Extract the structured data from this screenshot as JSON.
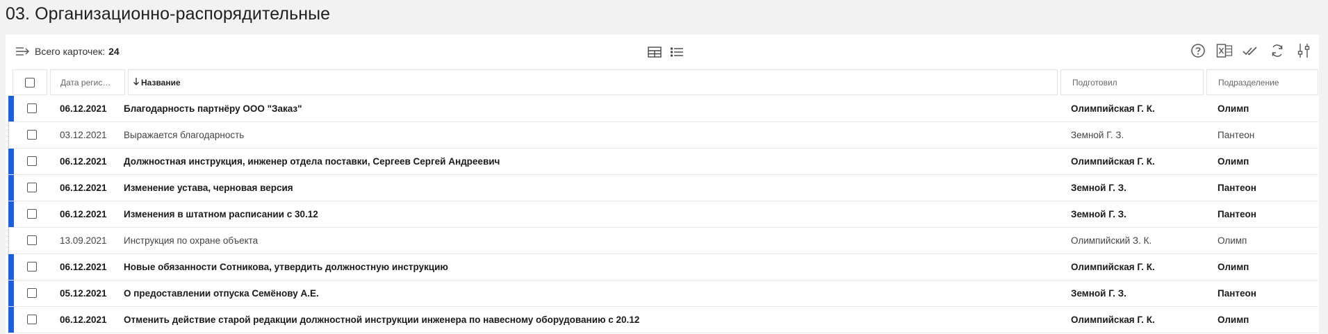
{
  "page": {
    "title": "03. Организационно-распорядительные"
  },
  "toolbar": {
    "count_label": "Всего карточек:",
    "count_value": "24",
    "icons": {
      "menu": "menu-arrow-icon",
      "table_view": "table-view-icon",
      "list_view": "list-view-icon",
      "help": "help-icon",
      "excel": "excel-export-icon",
      "mark_read": "double-check-icon",
      "refresh": "refresh-icon",
      "settings": "sliders-icon"
    }
  },
  "table": {
    "sort_column": "name",
    "sort_direction": "desc",
    "headers": {
      "date": "Дата регис…",
      "name": "Название",
      "author": "Подготовил",
      "department": "Подразделение"
    },
    "rows": [
      {
        "unread": true,
        "date": "06.12.2021",
        "name": "Благодарность партнёру ООО \"Заказ\"",
        "author": "Олимпийская Г. К.",
        "department": "Олимп"
      },
      {
        "unread": false,
        "date": "03.12.2021",
        "name": "Выражается благодарность",
        "author": "Земной Г. З.",
        "department": "Пантеон"
      },
      {
        "unread": true,
        "date": "06.12.2021",
        "name": "Должностная инструкция, инженер отдела поставки, Сергеев Сергей Андреевич",
        "author": "Олимпийская Г. К.",
        "department": "Олимп"
      },
      {
        "unread": true,
        "date": "06.12.2021",
        "name": "Изменение устава, черновая версия",
        "author": "Земной Г. З.",
        "department": "Пантеон"
      },
      {
        "unread": true,
        "date": "06.12.2021",
        "name": "Изменения в штатном расписании с 30.12",
        "author": "Земной Г. З.",
        "department": "Пантеон"
      },
      {
        "unread": false,
        "date": "13.09.2021",
        "name": "Инструкция по охране объекта",
        "author": "Олимпийский З. К.",
        "department": "Олимп"
      },
      {
        "unread": true,
        "date": "06.12.2021",
        "name": "Новые обязанности Сотникова, утвердить должностную инструкцию",
        "author": "Олимпийская Г. К.",
        "department": "Олимп"
      },
      {
        "unread": true,
        "date": "05.12.2021",
        "name": "О предоставлении отпуска Семёнову А.Е.",
        "author": "Земной Г. З.",
        "department": "Пантеон"
      },
      {
        "unread": true,
        "date": "06.12.2021",
        "name": "Отменить действие старой редакции должностной инструкции инженера по навесному оборудованию с 20.12",
        "author": "Олимпийская Г. К.",
        "department": "Олимп"
      }
    ]
  },
  "colors": {
    "accent": "#1a5fdc",
    "background": "#f2f2f2",
    "panel": "#ffffff"
  }
}
